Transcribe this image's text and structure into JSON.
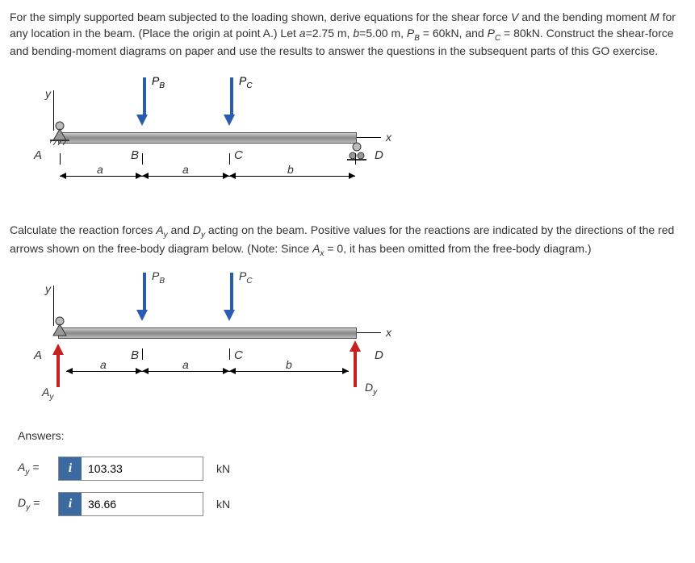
{
  "problem": {
    "text_html": "For the simply supported beam subjected to the loading shown, derive equations for the shear force <i>V</i> and the bending moment <i>M</i> for any location in the beam. (Place the origin at point A.) Let <i>a</i>=2.75 m, <i>b</i>=5.00 m, <i>P<sub>B</sub></i> = 60kN, and <i>P<sub>C</sub></i> = 80kN. Construct the shear-force and bending-moment diagrams on paper and use the results to answer the questions in the subsequent parts of this GO exercise."
  },
  "diagram1": {
    "y": "y",
    "x": "x",
    "PB": "P",
    "PB_sub": "B",
    "PC": "P",
    "PC_sub": "C",
    "A": "A",
    "B": "B",
    "C": "C",
    "D": "D",
    "a1": "a",
    "a2": "a",
    "b": "b"
  },
  "calc_text_html": "Calculate the reaction forces <i>A<sub>y</sub></i> and <i>D<sub>y</sub></i> acting on the beam. Positive values for the reactions are indicated by the directions of the red arrows shown on the free-body diagram below. (Note: Since <i>A<sub>x</sub></i> = 0, it has been omitted from the free-body diagram.)",
  "diagram2": {
    "y": "y",
    "x": "x",
    "PB": "P",
    "PB_sub": "B",
    "PC": "P",
    "PC_sub": "C",
    "A": "A",
    "B": "B",
    "C": "C",
    "D": "D",
    "a1": "a",
    "a2": "a",
    "b": "b",
    "Ay": "A",
    "Ay_sub": "y",
    "Dy": "D",
    "Dy_sub": "y"
  },
  "answers_label": "Answers:",
  "answers": {
    "Ay": {
      "var": "A",
      "sub": "y",
      "eq": "=",
      "value": "103.33",
      "unit": "kN"
    },
    "Dy": {
      "var": "D",
      "sub": "y",
      "eq": "=",
      "value": "36.66",
      "unit": "kN"
    }
  },
  "hint_icon": "i"
}
